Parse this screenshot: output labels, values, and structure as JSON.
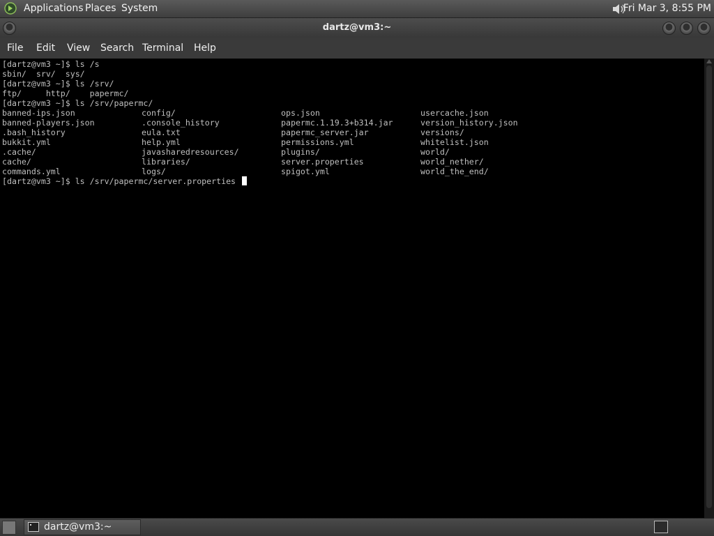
{
  "top_panel": {
    "menus": [
      "Applications",
      "Places",
      "System"
    ],
    "clock": "Fri Mar  3,  8:55 PM"
  },
  "window": {
    "title": "dartz@vm3:~"
  },
  "menubar": {
    "items": [
      "File",
      "Edit",
      "View",
      "Search",
      "Terminal",
      "Help"
    ]
  },
  "terminal": {
    "lines": [
      "[dartz@vm3 ~]$ ls /s",
      "sbin/  srv/  sys/",
      "[dartz@vm3 ~]$ ls /srv/",
      "ftp/     http/    papermc/",
      "[dartz@vm3 ~]$ ls /srv/papermc/"
    ],
    "listing": [
      [
        "banned-ips.json",
        "config/",
        "ops.json",
        "usercache.json"
      ],
      [
        "banned-players.json",
        ".console_history",
        "papermc.1.19.3+b314.jar",
        "version_history.json"
      ],
      [
        ".bash_history",
        "eula.txt",
        "papermc_server.jar",
        "versions/"
      ],
      [
        "bukkit.yml",
        "help.yml",
        "permissions.yml",
        "whitelist.json"
      ],
      [
        ".cache/",
        "javasharedresources/",
        "plugins/",
        "world/"
      ],
      [
        "cache/",
        "libraries/",
        "server.properties",
        "world_nether/"
      ],
      [
        "commands.yml",
        "logs/",
        "spigot.yml",
        "world_the_end/"
      ]
    ],
    "current_prompt": "[dartz@vm3 ~]$ ls /srv/papermc/server.properties "
  },
  "taskbar": {
    "window_label": "dartz@vm3:~"
  },
  "icons": {
    "logo": "distro-logo-icon",
    "volume": "volume-icon",
    "show_desktop": "show-desktop-icon",
    "terminal": "terminal-icon",
    "workspace": "workspace-switcher-icon"
  },
  "colors": {
    "terminal_bg": "#000000",
    "terminal_fg": "#bfbfbf",
    "panel_bg": "#3e3e3e"
  }
}
